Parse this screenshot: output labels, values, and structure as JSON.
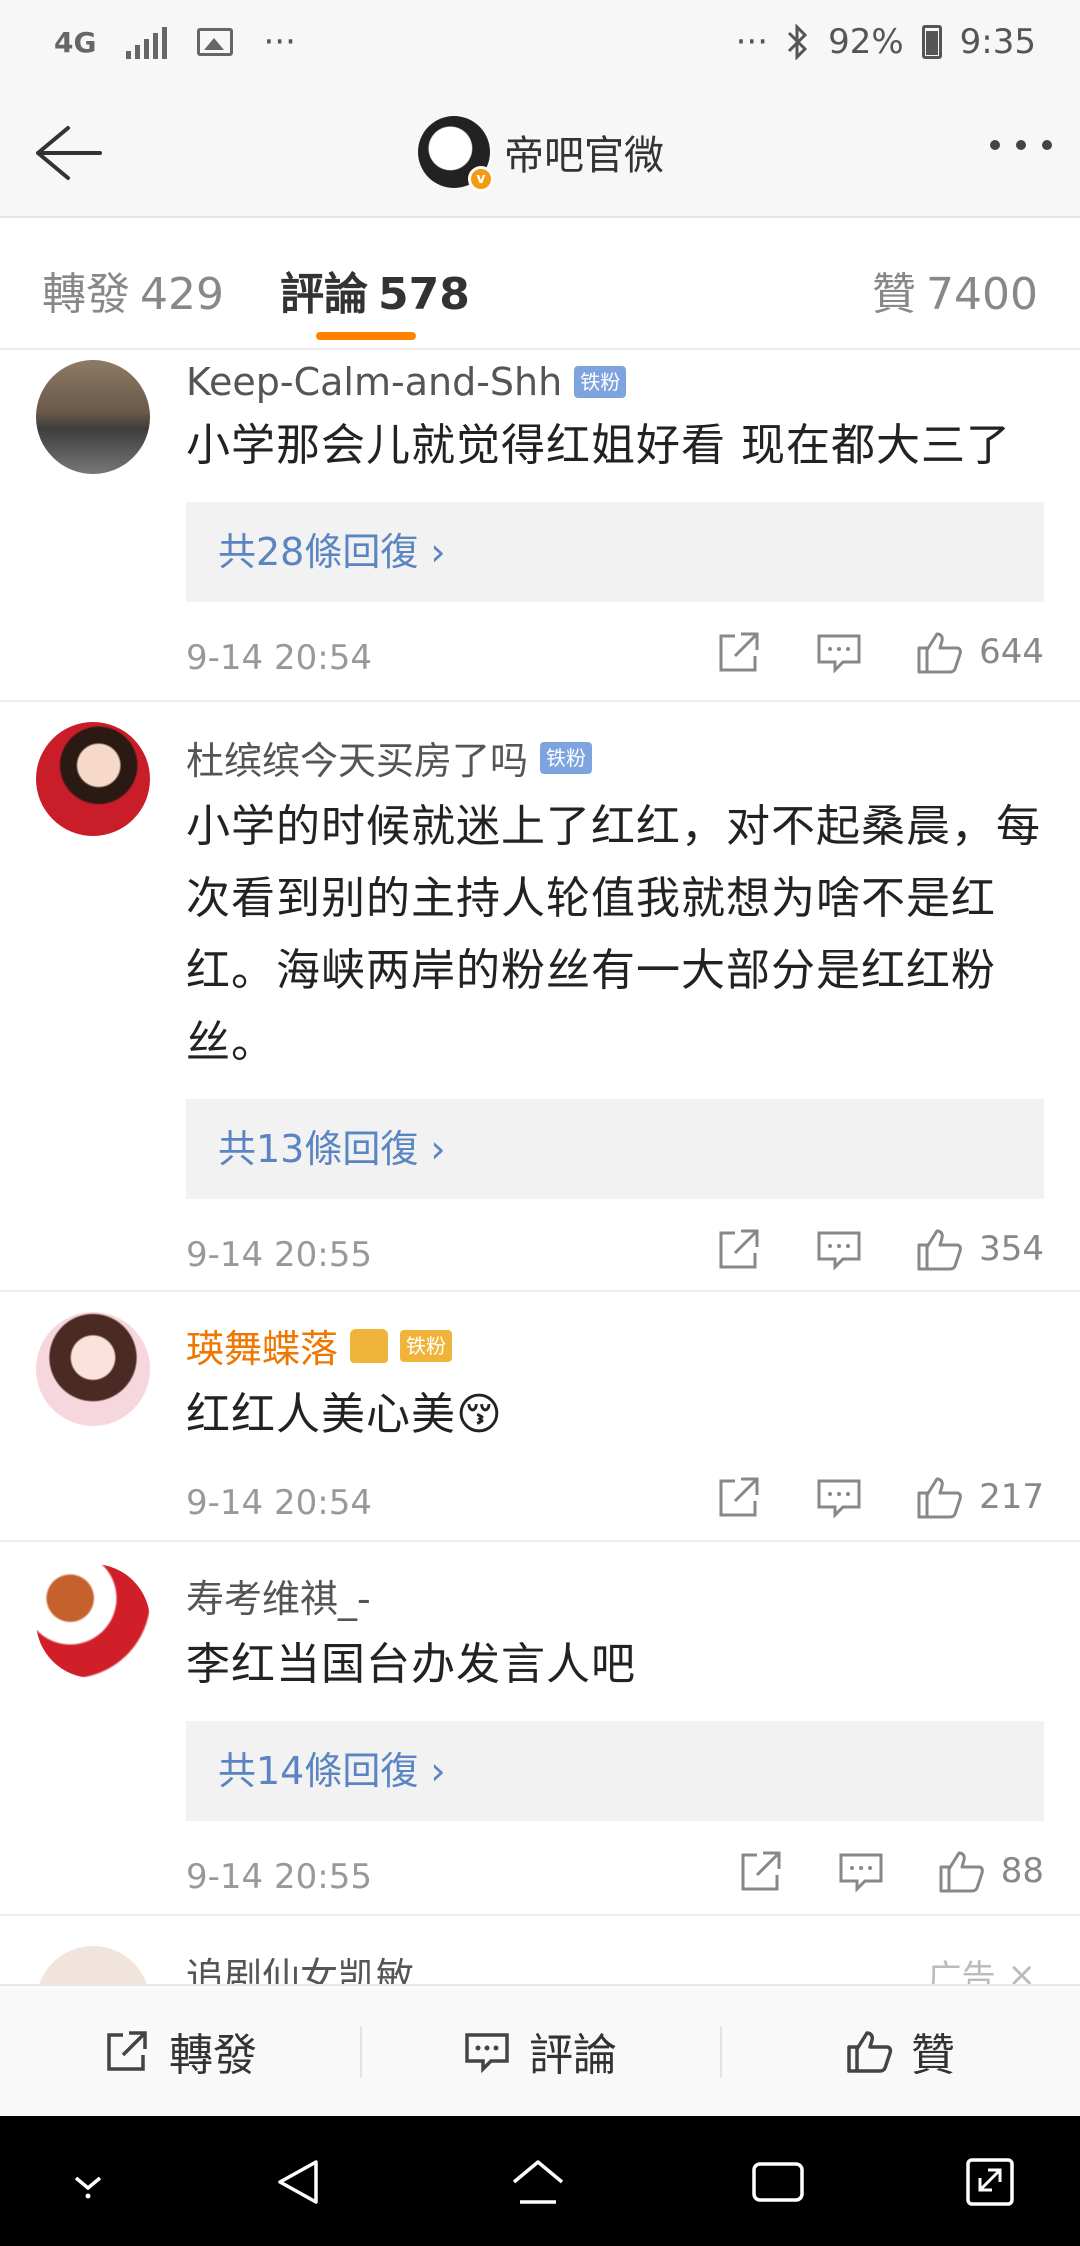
{
  "status_bar": {
    "network": "4G",
    "more_left": "···",
    "more_right": "···",
    "battery": "92%",
    "time": "9:35"
  },
  "header": {
    "title": "帝吧官微"
  },
  "tabs": [
    {
      "label": "轉發",
      "count": "429"
    },
    {
      "label": "評論",
      "count": "578"
    },
    {
      "label": "贊",
      "count": "7400"
    }
  ],
  "comments": [
    {
      "user": "Keep-Calm-and-Shh",
      "badge": "铁粉",
      "text": "小学那会儿就觉得红姐好看  现在都大三了",
      "replies": "共28條回復 ›",
      "time": "9-14 20:54",
      "likes": "644"
    },
    {
      "user": "杜缤缤今天买房了吗",
      "badge": "铁粉",
      "text": "小学的时候就迷上了红红，对不起桑晨，每次看到别的主持人轮值我就想为啥不是红红。海峡两岸的粉丝有一大部分是红红粉丝。",
      "replies": "共13條回復 ›",
      "time": "9-14 20:55",
      "likes": "354"
    },
    {
      "user": "瑛舞蝶落",
      "badge": "铁粉",
      "text": "红红人美心美😚",
      "time": "9-14 20:54",
      "likes": "217"
    },
    {
      "user": "寿考维祺_-",
      "text": "李红当国台办发言人吧",
      "replies": "共14條回復 ›",
      "time": "9-14 20:55",
      "likes": "88"
    }
  ],
  "ad": {
    "user": "追剧仙女凯敏",
    "tag": "广告",
    "close": "×"
  },
  "action_bar": {
    "repost": "轉發",
    "comment": "評論",
    "like": "贊"
  },
  "colors": {
    "accent": "#ff8200",
    "link": "#5a84c2",
    "vip_name": "#ee7700"
  }
}
